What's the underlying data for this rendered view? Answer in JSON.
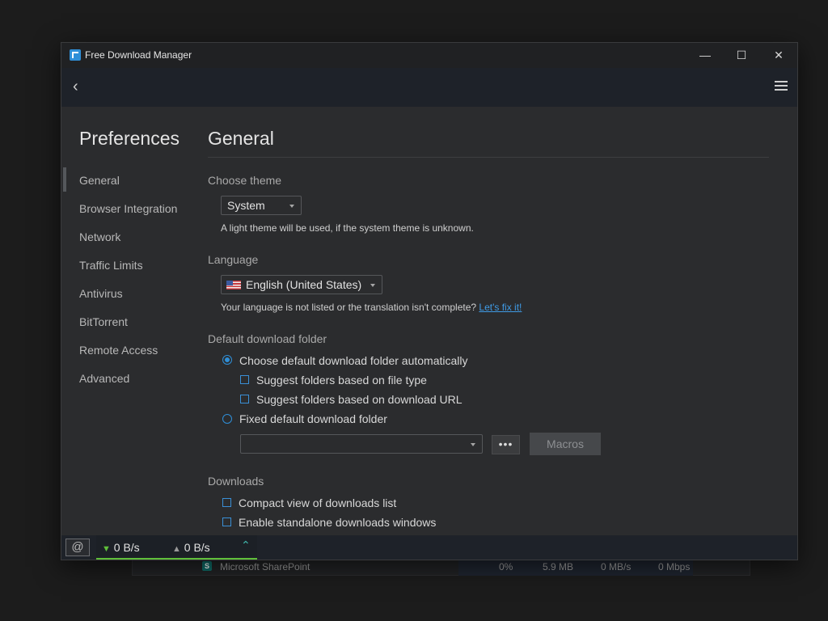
{
  "background_row": {
    "name": "Microsoft SharePoint",
    "progress": "0%",
    "size": "5.9 MB",
    "speed": "0 MB/s",
    "rate": "0 Mbps"
  },
  "window": {
    "title": "Free Download Manager",
    "controls": {
      "minimize": "—",
      "maximize": "☐",
      "close": "✕"
    }
  },
  "sidebar": {
    "title": "Preferences",
    "items": [
      {
        "label": "General",
        "active": true
      },
      {
        "label": "Browser Integration"
      },
      {
        "label": "Network"
      },
      {
        "label": "Traffic Limits"
      },
      {
        "label": "Antivirus"
      },
      {
        "label": "BitTorrent"
      },
      {
        "label": "Remote Access"
      },
      {
        "label": "Advanced"
      }
    ]
  },
  "main": {
    "title": "General",
    "theme": {
      "label": "Choose theme",
      "value": "System",
      "note": "A light theme will be used, if the system theme is unknown."
    },
    "language": {
      "label": "Language",
      "value": "English (United States)",
      "note": "Your language is not listed or the translation isn't complete?",
      "link": "Let's fix it!"
    },
    "folder": {
      "label": "Default download folder",
      "auto": "Choose default download folder automatically",
      "by_type": "Suggest folders based on file type",
      "by_url": "Suggest folders based on download URL",
      "fixed": "Fixed default download folder",
      "path_value": "",
      "browse": "•••",
      "macros": "Macros"
    },
    "downloads": {
      "label": "Downloads",
      "compact": "Compact view of downloads list",
      "standalone": "Enable standalone downloads windows"
    }
  },
  "statusbar": {
    "down_speed": "0 B/s",
    "up_speed": "0 B/s"
  },
  "colors": {
    "accent": "#2f8fd8",
    "speed_bar": "#5fbf3a"
  }
}
